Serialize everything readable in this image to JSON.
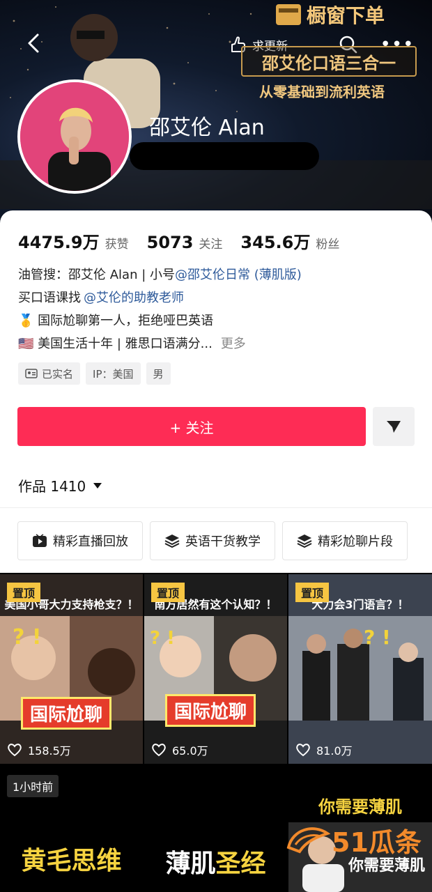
{
  "header": {
    "shop_label": "橱窗下单",
    "request_update_label": "求更新",
    "course_title": "邵艾伦口语三合一",
    "course_subtitle": "从零基础到流利英语"
  },
  "profile": {
    "display_name": "邵艾伦 Alan",
    "stats": [
      {
        "value": "4475.9万",
        "label": "获赞"
      },
      {
        "value": "5073",
        "label": "关注"
      },
      {
        "value": "345.6万",
        "label": "粉丝"
      }
    ],
    "bio": {
      "line1_prefix": "油管搜：邵艾伦 Alan | 小号",
      "line1_link": "@邵艾伦日常 (薄肌版)",
      "line2_prefix": "买口语课找",
      "line2_link": "@艾伦的助教老师",
      "line3": "🥇 国际尬聊第一人，拒绝哑巴英语",
      "line4": "🇺🇸 美国生活十年 | 雅思口语满分...",
      "more": "更多"
    },
    "tags": [
      "已实名",
      "IP：美国",
      "男"
    ],
    "follow_label": "+ 关注",
    "works_label": "作品 1410"
  },
  "collections": [
    "精彩直播回放",
    "英语干货教学",
    "精彩尬聊片段"
  ],
  "videos": [
    {
      "pin": "置顶",
      "title": "美国小哥大力支持枪支？！",
      "cover": "国际尬聊",
      "likes": "158.5万"
    },
    {
      "pin": "置顶",
      "title": "南方居然有这个认知？！",
      "cover": "国际尬聊",
      "likes": "65.0万"
    },
    {
      "pin": "置顶",
      "title": "大力会3门语言？！",
      "cover": "",
      "likes": "81.0万"
    },
    {
      "badge": "1小时前",
      "cover": "黄毛思维"
    },
    {
      "cover_a": "薄肌",
      "cover_b": "圣经"
    },
    {
      "title": "你需要薄肌",
      "cover": "你需要薄肌"
    }
  ],
  "watermark": "51瓜条"
}
